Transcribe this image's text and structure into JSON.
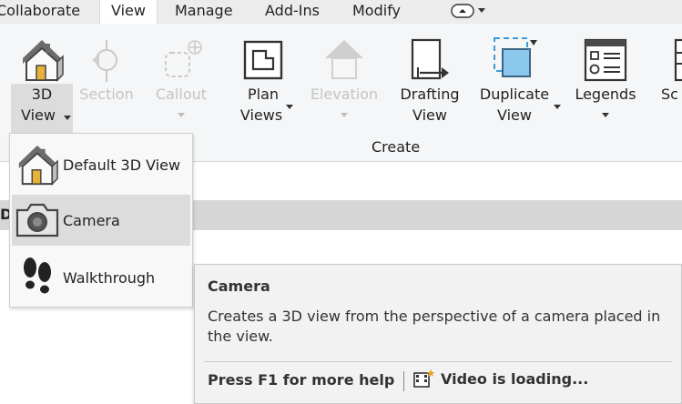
{
  "tabs": [
    {
      "label": "Collaborate",
      "active": false
    },
    {
      "label": "View",
      "active": true
    },
    {
      "label": "Manage",
      "active": false
    },
    {
      "label": "Add-Ins",
      "active": false
    },
    {
      "label": "Modify",
      "active": false
    }
  ],
  "ribbon": {
    "panel_label": "Create",
    "buttons": [
      {
        "line1": "3D",
        "line2": "View",
        "icon": "house-3d-icon",
        "has_arrow": true,
        "enabled": true,
        "pressed": true
      },
      {
        "line1": "Section",
        "line2": "",
        "icon": "section-icon",
        "has_arrow": false,
        "enabled": false
      },
      {
        "line1": "Callout",
        "line2": "",
        "icon": "callout-icon",
        "has_arrow": true,
        "enabled": false
      },
      {
        "line1": "Plan",
        "line2": "Views",
        "icon": "plan-views-icon",
        "has_arrow": true,
        "enabled": true
      },
      {
        "line1": "Elevation",
        "line2": "",
        "icon": "elevation-icon",
        "has_arrow": true,
        "enabled": false
      },
      {
        "line1": "Drafting",
        "line2": "View",
        "icon": "drafting-view-icon",
        "has_arrow": false,
        "enabled": true
      },
      {
        "line1": "Duplicate",
        "line2": "View",
        "icon": "duplicate-view-icon",
        "has_arrow": true,
        "enabled": true
      },
      {
        "line1": "Legends",
        "line2": "",
        "icon": "legends-icon",
        "has_arrow": true,
        "enabled": true
      },
      {
        "line1": "Sc",
        "line2": "",
        "icon": "schedules-icon",
        "has_arrow": false,
        "enabled": true
      }
    ]
  },
  "dropdown": {
    "items": [
      {
        "label": "Default 3D View",
        "icon": "house-3d-icon",
        "hover": false
      },
      {
        "label": "Camera",
        "icon": "camera-icon",
        "hover": true
      },
      {
        "label": "Walkthrough",
        "icon": "footprints-icon",
        "hover": false
      }
    ]
  },
  "tooltip": {
    "title": "Camera",
    "description": "Creates a 3D view from the perspective of a camera placed in the view.",
    "help": "Press F1 for more help",
    "video": "Video is loading..."
  },
  "below_ribbon_text": "D",
  "colors": {
    "tab_bar": "#ececec",
    "ribbon_bg": "#f5f6f7",
    "pressed_bg": "#dcdcdc",
    "disabled_text": "#c4c4c4",
    "tooltip_bg": "#f2f2f2",
    "duplicate_icon_blue": "#3c9ad6"
  }
}
